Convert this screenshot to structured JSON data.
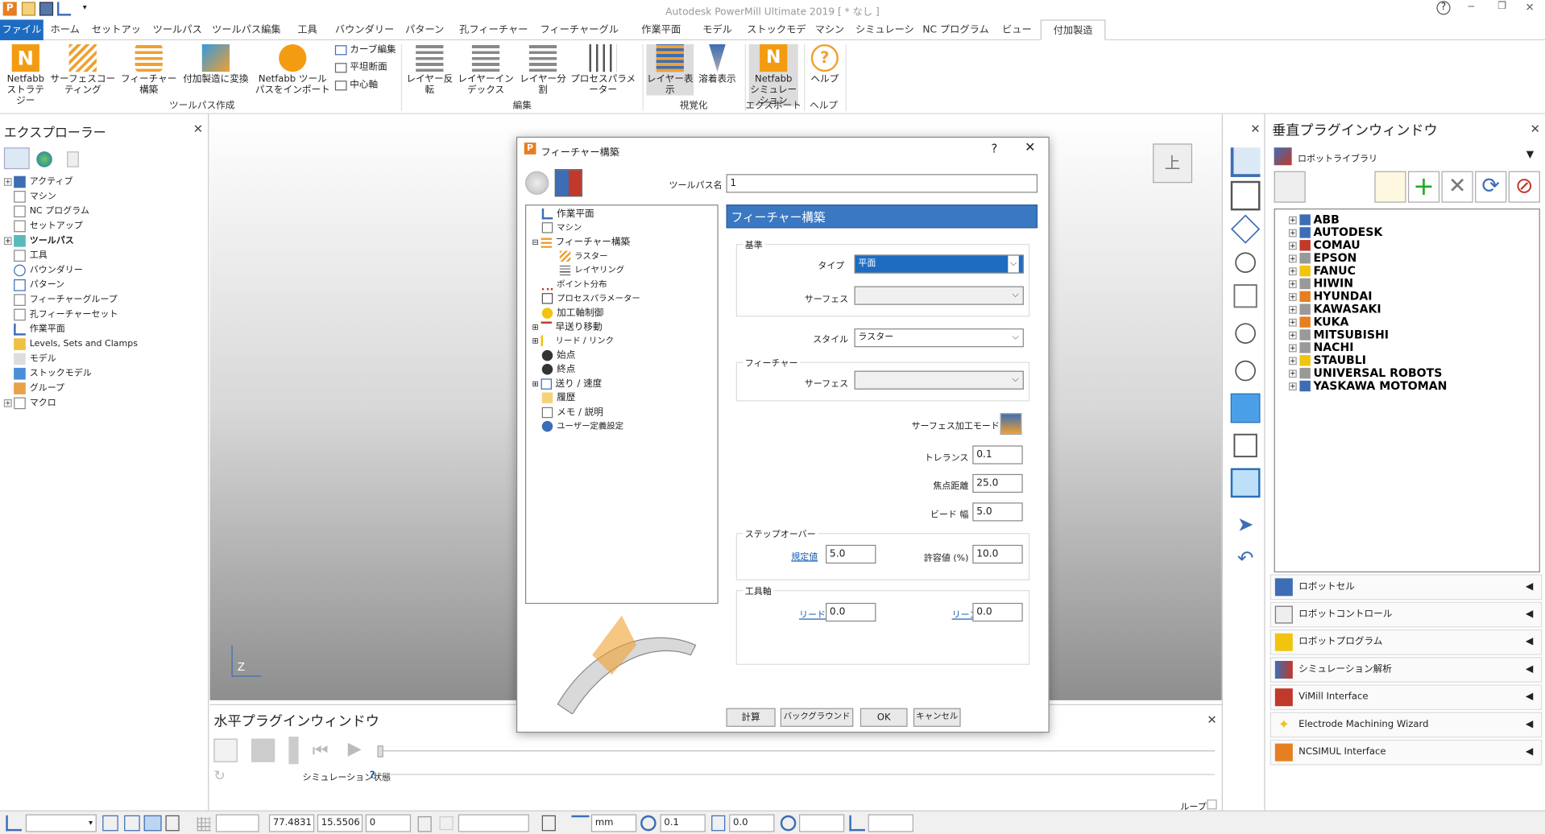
{
  "titlebar": {
    "title": "Autodesk PowerMill Ultimate 2019   [ * なし ]",
    "help": "?",
    "minimize": "─",
    "restore": "❐",
    "close": "✕"
  },
  "ribbon_tabs": [
    {
      "label": "ファイル",
      "left": 0,
      "width": 44
    },
    {
      "label": "ホーム"
    },
    {
      "label": "セットアップ"
    },
    {
      "label": "ツールパス"
    },
    {
      "label": "ツールパス編集"
    },
    {
      "label": "工具"
    },
    {
      "label": "バウンダリー"
    },
    {
      "label": "パターン"
    },
    {
      "label": "孔フィーチャーセット"
    },
    {
      "label": "フィーチャーグループ"
    },
    {
      "label": "作業平面"
    },
    {
      "label": "モデル"
    },
    {
      "label": "ストックモデル"
    },
    {
      "label": "マシン"
    },
    {
      "label": "シミュレーション"
    },
    {
      "label": "NC プログラム"
    },
    {
      "label": "ビュー"
    },
    {
      "label": "付加製造"
    }
  ],
  "ribbon": {
    "buttons": {
      "netfabb_strategy": "Netfabb ストラテジー",
      "surface_coating": "サーフェスコーティング",
      "feature_build": "フィーチャー構築",
      "convert_additive": "付加製造に変換",
      "netfabb_import": "Netfabb ツールパスをインポート",
      "curve_edit": "カーブ編集",
      "flat_section": "平坦断面",
      "center_axis": "中心軸",
      "layer_reverse": "レイヤー反転",
      "layer_index": "レイヤーインデックス",
      "layer_split": "レイヤー分割",
      "process_params": "プロセスパラメーター",
      "layer_display": "レイヤー表示",
      "deposit_display": "溶着表示",
      "netfabb_sim": "Netfabb シミュレーション",
      "help": "ヘルプ"
    },
    "groups": {
      "toolpath_create": "ツールパス作成",
      "edit": "編集",
      "visualize": "視覚化",
      "export": "エクスポート",
      "help": "ヘルプ"
    }
  },
  "explorer": {
    "title": "エクスプローラー",
    "items": [
      "アクティブ",
      "マシン",
      "NC プログラム",
      "セットアップ",
      "ツールパス",
      "工具",
      "バウンダリー",
      "パターン",
      "フィーチャーグループ",
      "孔フィーチャーセット",
      "作業平面",
      "Levels, Sets and Clamps",
      "モデル",
      "ストックモデル",
      "グループ",
      "マクロ"
    ]
  },
  "viewport": {
    "view_label": "上",
    "axis_label": "Z"
  },
  "hplugin": {
    "title": "水平プラグインウィンドウ",
    "sim_status": "シミュレーション状態",
    "loop": "ループ"
  },
  "vplugin": {
    "title": "垂直プラグインウィンドウ",
    "library": "ロボットライブラリ",
    "robots": [
      "ABB",
      "AUTODESK",
      "COMAU",
      "EPSON",
      "FANUC",
      "HIWIN",
      "HYUNDAI",
      "KAWASAKI",
      "KUKA",
      "MITSUBISHI",
      "NACHI",
      "STAUBLI",
      "UNIVERSAL ROBOTS",
      "YASKAWA MOTOMAN"
    ],
    "sections": [
      "ロボットセル",
      "ロボットコントロール",
      "ロボットプログラム",
      "シミュレーション解析",
      "ViMill Interface",
      "Electrode Machining Wizard",
      "NCSIMUL Interface"
    ]
  },
  "status": {
    "x": "77.4831",
    "y": "15.5506",
    "z": "0",
    "unit": "mm",
    "tol": "0.1",
    "tool": "0.0"
  },
  "dialog": {
    "title": "フィーチャー構築",
    "help": "?",
    "close": "✕",
    "toolpath_name_label": "ツールパス名",
    "toolpath_name": "1",
    "section_title": "フィーチャー構築",
    "tree": [
      "作業平面",
      "マシン",
      "フィーチャー構築",
      "ラスター",
      "レイヤリング",
      "ポイント分布",
      "プロセスパラメーター",
      "加工軸制御",
      "早送り移動",
      "リード / リンク",
      "始点",
      "終点",
      "送り / 速度",
      "履歴",
      "メモ / 説明",
      "ユーザー定義設定"
    ],
    "base_legend": "基準",
    "type_label": "タイプ",
    "type_value": "平面",
    "surface_label": "サーフェス",
    "style_label": "スタイル",
    "style_value": "ラスター",
    "feature_legend": "フィーチャー",
    "surface_label2": "サーフェス",
    "surface_mode_label": "サーフェス加工モード",
    "tolerance_label": "トレランス",
    "tolerance": "0.1",
    "focus_label": "焦点距離",
    "focus": "25.0",
    "bead_label": "ビード 幅",
    "bead": "5.0",
    "stepover_legend": "ステップオーバー",
    "default_link": "規定値",
    "default_value": "5.0",
    "allow_label": "許容値 (%)",
    "allow_value": "10.0",
    "toolaxis_legend": "工具軸",
    "lead_link": "リード",
    "lead_value": "0.0",
    "lean_link": "リーン",
    "lean_value": "0.0",
    "buttons": {
      "calc": "計算",
      "background": "バックグラウンド",
      "ok": "OK",
      "cancel": "キャンセル"
    }
  }
}
